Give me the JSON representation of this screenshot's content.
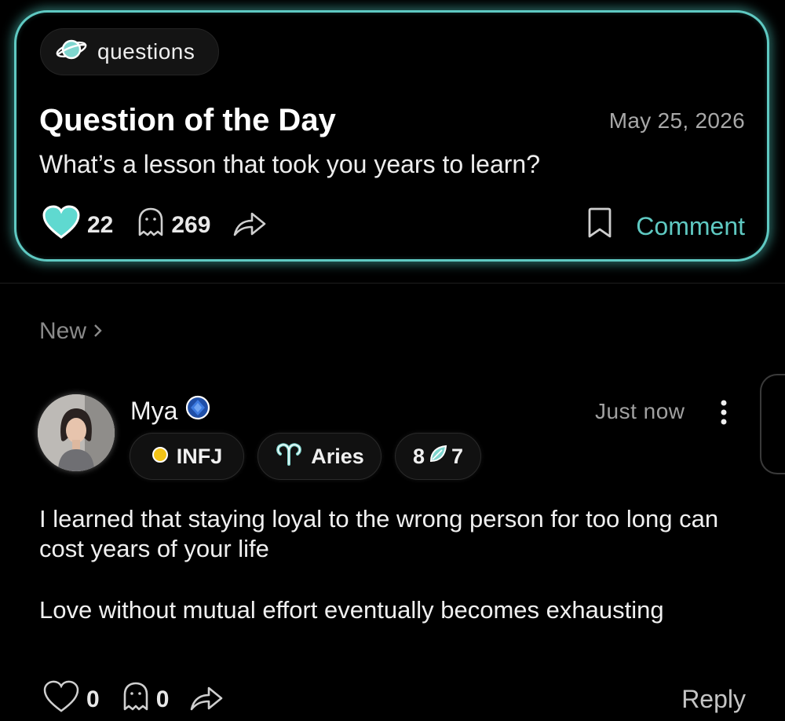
{
  "featured": {
    "tag": "questions",
    "tag_icon": "planet-icon",
    "title": "Question of the Day",
    "date": "May 25, 2026",
    "question": "What’s a lesson that took you years to learn?",
    "likes": "22",
    "comments": "269",
    "comment_label": "Comment",
    "accent_color": "#5fc9c2"
  },
  "feed": {
    "section_label": "New",
    "post": {
      "author": "Mya",
      "time": "Just now",
      "badges": {
        "personality": "INFJ",
        "zodiac": "Aries",
        "num_left": "8",
        "num_right": "7"
      },
      "body": [
        "I learned that staying loyal to the wrong person for too long can cost years of your life",
        "Love without mutual effort eventually becomes exhausting"
      ],
      "likes": "0",
      "comments": "0",
      "reply_label": "Reply"
    }
  }
}
